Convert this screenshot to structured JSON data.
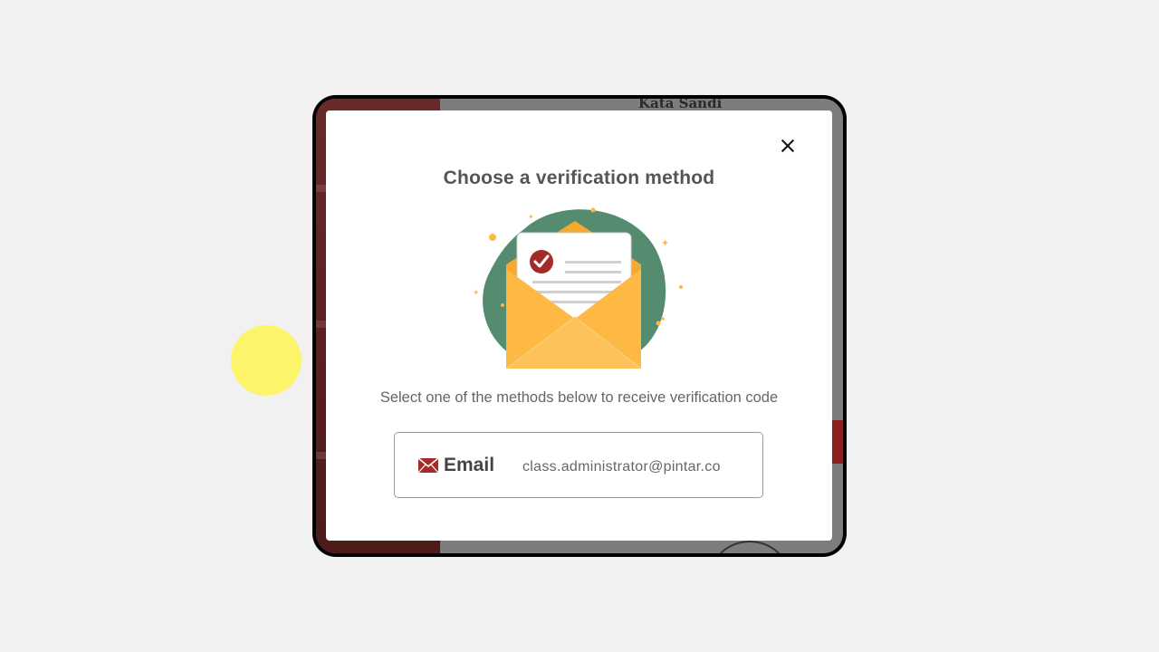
{
  "background": {
    "partial_heading": "Kata Sandi"
  },
  "modal": {
    "title": "Choose a verification method",
    "subtitle": "Select one of the methods below to receive verification code",
    "close_label": "×",
    "methods": [
      {
        "icon": "envelope-icon",
        "label": "Email",
        "value": "class.administrator@pintar.co"
      }
    ]
  },
  "colors": {
    "accent_red": "#a52a2a",
    "envelope_yellow": "#fdb944",
    "blob_green": "#558b6e"
  }
}
